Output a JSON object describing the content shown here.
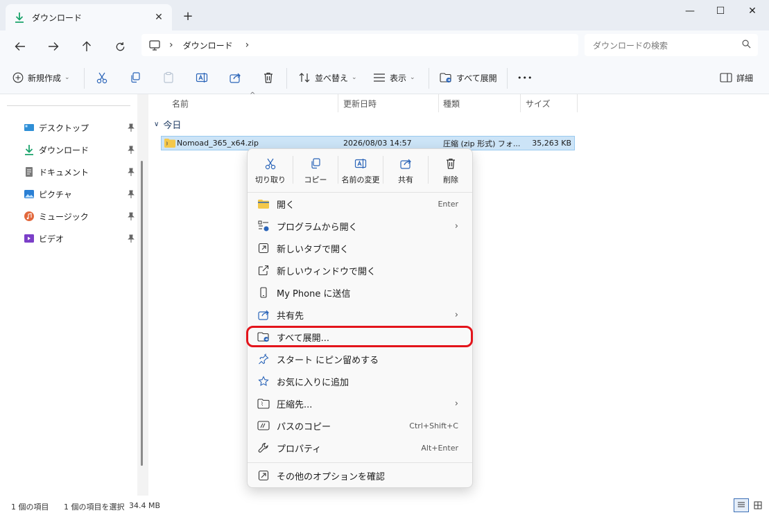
{
  "window": {
    "tab_title": "ダウンロード",
    "tab_close": "✕",
    "new_tab": "+",
    "minimize": "—",
    "maximize": "☐",
    "close": "✕"
  },
  "address": {
    "sep1": "›",
    "crumb": "ダウンロード",
    "sep2": "›",
    "search_placeholder": "ダウンロードの検索"
  },
  "commandbar": {
    "new": "新規作成",
    "sort": "並べ替え",
    "view": "表示",
    "extract_all": "すべて展開",
    "more": "•••",
    "details": "詳細"
  },
  "sidebar": {
    "items": [
      {
        "label": "デスクトップ",
        "color": "#2f8fd6"
      },
      {
        "label": "ダウンロード",
        "color": "#1aa36b"
      },
      {
        "label": "ドキュメント",
        "color": "#7a7a7a"
      },
      {
        "label": "ピクチャ",
        "color": "#2a7fd4"
      },
      {
        "label": "ミュージック",
        "color": "#e2683c"
      },
      {
        "label": "ビデオ",
        "color": "#7b3fc8"
      }
    ]
  },
  "columns": {
    "name": "名前",
    "date": "更新日時",
    "type": "種類",
    "size": "サイズ",
    "sort_indicator": "^"
  },
  "group": {
    "label": "今日",
    "chevron": "∨"
  },
  "file": {
    "name": "Nomoad_365_x64.zip",
    "date": "2026/08/03 14:57",
    "type": "圧縮 (zip 形式) フォ...",
    "size": "35,263 KB"
  },
  "context_menu": {
    "quick_actions": [
      {
        "label": "切り取り",
        "icon": "cut-icon"
      },
      {
        "label": "コピー",
        "icon": "copy-icon"
      },
      {
        "label": "名前の変更",
        "icon": "rename-icon"
      },
      {
        "label": "共有",
        "icon": "share-icon"
      },
      {
        "label": "削除",
        "icon": "delete-icon"
      }
    ],
    "items": [
      {
        "label": "開く",
        "shortcut": "Enter",
        "arrow": ""
      },
      {
        "label": "プログラムから開く",
        "shortcut": "",
        "arrow": "›"
      },
      {
        "label": "新しいタブで開く",
        "shortcut": "",
        "arrow": ""
      },
      {
        "label": "新しいウィンドウで開く",
        "shortcut": "",
        "arrow": ""
      },
      {
        "label": "My Phone に送信",
        "shortcut": "",
        "arrow": ""
      },
      {
        "label": "共有先",
        "shortcut": "",
        "arrow": "›"
      },
      {
        "label": "すべて展開...",
        "shortcut": "",
        "arrow": ""
      },
      {
        "label": "スタート にピン留めする",
        "shortcut": "",
        "arrow": ""
      },
      {
        "label": "お気に入りに追加",
        "shortcut": "",
        "arrow": ""
      },
      {
        "label": "圧縮先...",
        "shortcut": "",
        "arrow": "›"
      },
      {
        "label": "パスのコピー",
        "shortcut": "Ctrl+Shift+C",
        "arrow": ""
      },
      {
        "label": "プロパティ",
        "shortcut": "Alt+Enter",
        "arrow": ""
      }
    ],
    "more_options": "その他のオプションを確認"
  },
  "status": {
    "count": "1 個の項目",
    "selected": "1 個の項目を選択",
    "size": "34.4 MB"
  },
  "colors": {
    "highlight": "#e3141b",
    "selection": "#cce4f7"
  }
}
